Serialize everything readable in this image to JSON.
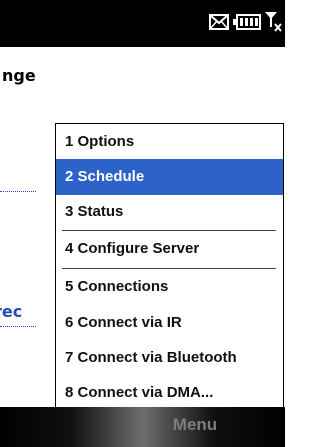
{
  "window": {
    "title": "nge"
  },
  "status_icons": [
    "mail-icon",
    "battery-icon",
    "signal-off-icon"
  ],
  "background_link": "rec",
  "menu": {
    "items": [
      {
        "label": "1 Options",
        "selected": false
      },
      {
        "label": "2 Schedule",
        "selected": true
      },
      {
        "label": "3 Status",
        "selected": false
      },
      {
        "label": "4 Configure Server",
        "selected": false
      },
      {
        "label": "5 Connections",
        "selected": false
      },
      {
        "label": "6 Connect via IR",
        "selected": false
      },
      {
        "label": "7 Connect via Bluetooth",
        "selected": false
      },
      {
        "label": "8 Connect via DMA...",
        "selected": false
      }
    ]
  },
  "softkeys": {
    "right_label": "Menu"
  },
  "colors": {
    "selection": "#2d63c8",
    "link": "#1f4fb0"
  }
}
